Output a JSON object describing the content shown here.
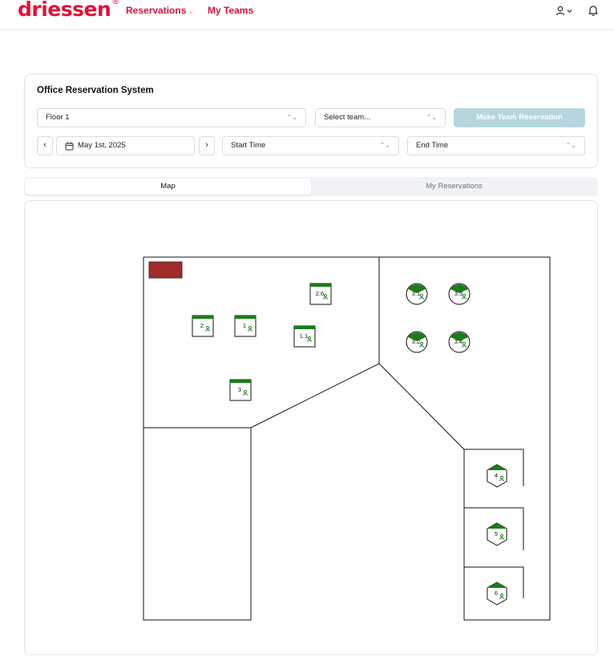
{
  "header": {
    "logo": "driessen",
    "logo_mark": "®",
    "nav": [
      {
        "label": "Reservations",
        "has_dropdown": true
      },
      {
        "label": "My Teams",
        "has_dropdown": false
      }
    ],
    "icons": [
      "user-icon",
      "chevron-down-icon",
      "bell-icon"
    ]
  },
  "reservation_panel": {
    "title": "Office Reservation System",
    "floor_select": "Floor 1",
    "team_select": "Select team...",
    "make_button": "Make Team Reservation",
    "date": "May 1st, 2025",
    "start_time": "Start Time",
    "end_time": "End Time"
  },
  "tabs": [
    {
      "label": "Map",
      "active": true
    },
    {
      "label": "My Reservations",
      "active": false
    }
  ],
  "map": {
    "colors": {
      "desk_available": "#1a7d1a",
      "blocked_area": "#a32b2b",
      "wall": "#111111"
    },
    "desks": [
      {
        "id": "2.6",
        "shape": "square"
      },
      {
        "id": "2",
        "shape": "square"
      },
      {
        "id": "1",
        "shape": "square"
      },
      {
        "id": "1.1",
        "shape": "square"
      },
      {
        "id": "3",
        "shape": "square"
      },
      {
        "id": "3.1",
        "shape": "circle"
      },
      {
        "id": "3.3",
        "shape": "circle"
      },
      {
        "id": "3.2",
        "shape": "circle"
      },
      {
        "id": "3.4",
        "shape": "circle"
      },
      {
        "id": "4",
        "shape": "hexagon"
      },
      {
        "id": "5",
        "shape": "hexagon"
      },
      {
        "id": "6",
        "shape": "hexagon"
      }
    ]
  }
}
